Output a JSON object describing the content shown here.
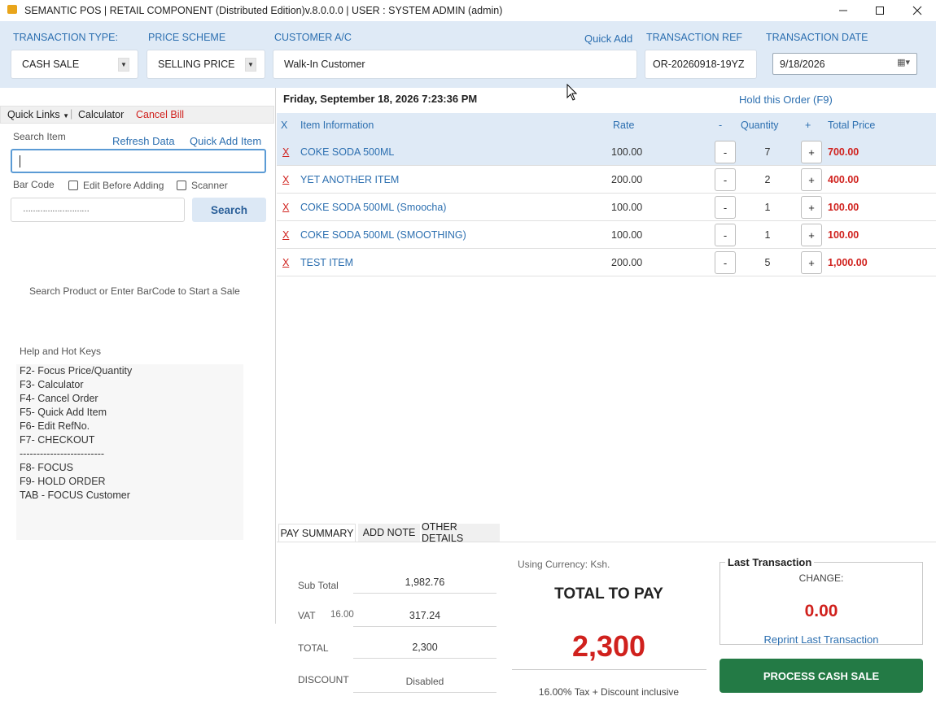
{
  "window": {
    "title": "SEMANTIC POS | RETAIL COMPONENT  (Distributed Edition)v.8.0.0.0 | USER : SYSTEM ADMIN (admin)",
    "minimize_icon": "minimize-icon",
    "maximize_icon": "maximize-icon",
    "close_icon": "close-icon"
  },
  "header": {
    "transaction_type_label": "TRANSACTION TYPE:",
    "transaction_type_value": "CASH SALE",
    "price_scheme_label": "PRICE SCHEME",
    "price_scheme_value": "SELLING PRICE",
    "customer_label": "CUSTOMER A/C",
    "quick_add": "Quick Add",
    "customer_value": "Walk-In Customer",
    "transaction_ref_label": "TRANSACTION REF",
    "transaction_ref_value": "OR-20260918-19YZ",
    "transaction_date_label": "TRANSACTION DATE",
    "transaction_date_value": "9/18/2026"
  },
  "left": {
    "quick_links": "Quick Links",
    "calculator": "Calculator",
    "cancel_bill": "Cancel Bill",
    "search_item_label": "Search Item",
    "refresh_data": "Refresh Data",
    "quick_add_item": "Quick Add Item",
    "barcode_label": "Bar Code",
    "edit_before_adding": "Edit Before Adding",
    "scanner": "Scanner",
    "barcode_value": "………………………",
    "search_button": "Search",
    "hint": "Search Product or Enter BarCode to Start a Sale",
    "help_title": "Help and Hot Keys",
    "help_lines": [
      "F2- Focus Price/Quantity",
      "F3- Calculator",
      "F4- Cancel Order",
      "F5- Quick Add Item",
      "F6- Edit RefNo.",
      "F7- CHECKOUT",
      "-------------------------",
      "F8- FOCUS",
      "F9- HOLD ORDER",
      "TAB - FOCUS Customer"
    ]
  },
  "main": {
    "datetime": "Friday, September 18, 2026  7:23:36 PM",
    "hold_order": "Hold this Order (F9)",
    "columns": {
      "x": "X",
      "item": "Item Information",
      "rate": "Rate",
      "minus": "-",
      "quantity": "Quantity",
      "plus": "+",
      "total": "Total Price"
    },
    "rows": [
      {
        "x": "X",
        "name": "COKE SODA 500ML",
        "rate": "100.00",
        "minus": "-",
        "qty": "7",
        "plus": "+",
        "total": "700.00"
      },
      {
        "x": "X",
        "name": "YET ANOTHER ITEM",
        "rate": "200.00",
        "minus": "-",
        "qty": "2",
        "plus": "+",
        "total": "400.00"
      },
      {
        "x": "X",
        "name": "COKE SODA 500ML (Smoocha)",
        "rate": "100.00",
        "minus": "-",
        "qty": "1",
        "plus": "+",
        "total": "100.00"
      },
      {
        "x": "X",
        "name": "COKE SODA 500ML (SMOOTHING)",
        "rate": "100.00",
        "minus": "-",
        "qty": "1",
        "plus": "+",
        "total": "100.00"
      },
      {
        "x": "X",
        "name": "TEST ITEM",
        "rate": "200.00",
        "minus": "-",
        "qty": "5",
        "plus": "+",
        "total": "1,000.00"
      }
    ],
    "selected_row_index": 0
  },
  "tabs": [
    "PAY SUMMARY",
    "ADD NOTE",
    "OTHER DETAILS"
  ],
  "summary": {
    "subtotal_label": "Sub Total",
    "subtotal_value": "1,982.76",
    "vat_label": "VAT",
    "vat_rate": "16.00",
    "vat_value": "317.24",
    "total_label": "TOTAL",
    "total_value": "2,300",
    "discount_label": "DISCOUNT",
    "discount_value": "Disabled",
    "currency": "Using Currency: Ksh.",
    "total_to_pay_label": "TOTAL TO PAY",
    "total_to_pay_value": "2,300",
    "tax_note": "16.00% Tax + Discount inclusive"
  },
  "last_transaction": {
    "title": "Last Transaction",
    "change_label": "CHANGE:",
    "change_value": "0.00",
    "reprint": "Reprint Last Transaction"
  },
  "process_button": "PROCESS CASH SALE",
  "colors": {
    "accent_blue": "#2c6fb0",
    "header_bg": "#dfeaf6",
    "alert_red": "#d0211d",
    "process_green": "#237a45"
  }
}
